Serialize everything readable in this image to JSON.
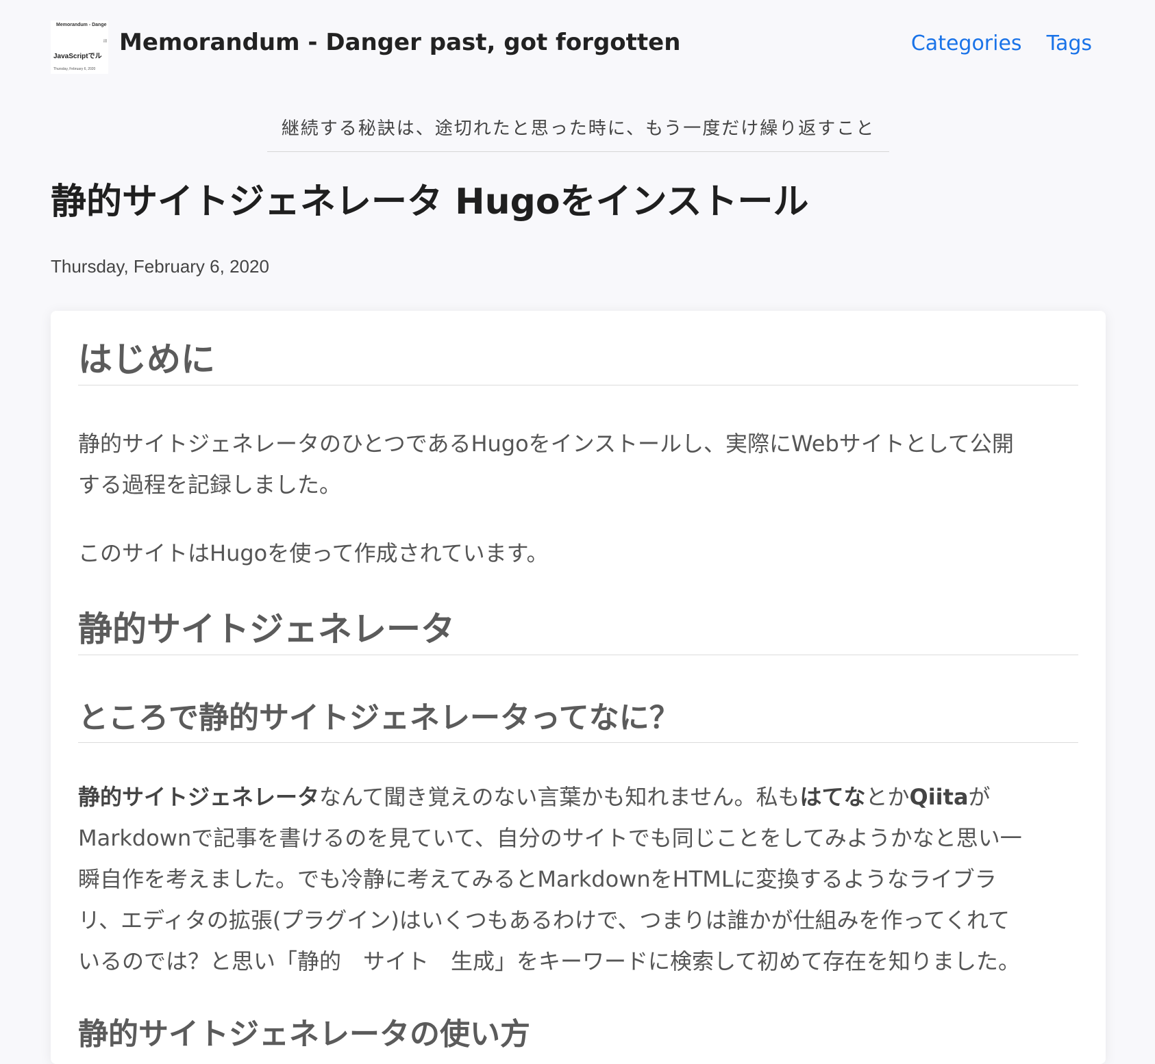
{
  "header": {
    "logo": {
      "line1": "Memorandum - Dange",
      "line2": "JavaScriptでル",
      "line3": "Thursday, February 6, 2020",
      "line4": "ill"
    },
    "site_title": "Memorandum - Danger past, got forgotten",
    "nav": [
      {
        "label": "Categories"
      },
      {
        "label": "Tags"
      }
    ]
  },
  "tagline": "継続する秘訣は、途切れたと思った時に、もう一度だけ繰り返すこと",
  "post": {
    "title": "静的サイトジェネレータ Hugoをインストール",
    "date": "Thursday, February 6, 2020",
    "sections": {
      "intro_heading": "はじめに",
      "intro_p1_line1": "静的サイトジェネレータのひとつであるHugoをインストールし、実際にWebサイトとして公開",
      "intro_p1_line2": "する過程を記録しました。",
      "intro_p2": "このサイトはHugoを使って作成されています。",
      "ssg_heading": "静的サイトジェネレータ",
      "what_heading": "ところで静的サイトジェネレータってなに？",
      "body": {
        "l1_bold1": "静的サイトジェネレータ",
        "l1_text1": "なんて聞き覚えのない言葉かも知れません。私も",
        "l1_bold2": "はてな",
        "l1_text2": "とか",
        "l1_bold3": "Qiita",
        "l1_text3": "が",
        "l2": "Markdownで記事を書けるのを見ていて、自分のサイトでも同じことをしてみようかなと思い一",
        "l3": "瞬自作を考えました。でも冷静に考えてみるとMarkdownをHTMLに変換するようなライブラ",
        "l4": "リ、エディタの拡張(プラグイン)はいくつもあるわけで、つまりは誰かが仕組みを作ってくれて",
        "l5": "いるのでは？と思い「静的　サイト　生成」をキーワードに検索して初めて存在を知りました。"
      },
      "howto_heading": "静的サイトジェネレータの使い方"
    }
  }
}
